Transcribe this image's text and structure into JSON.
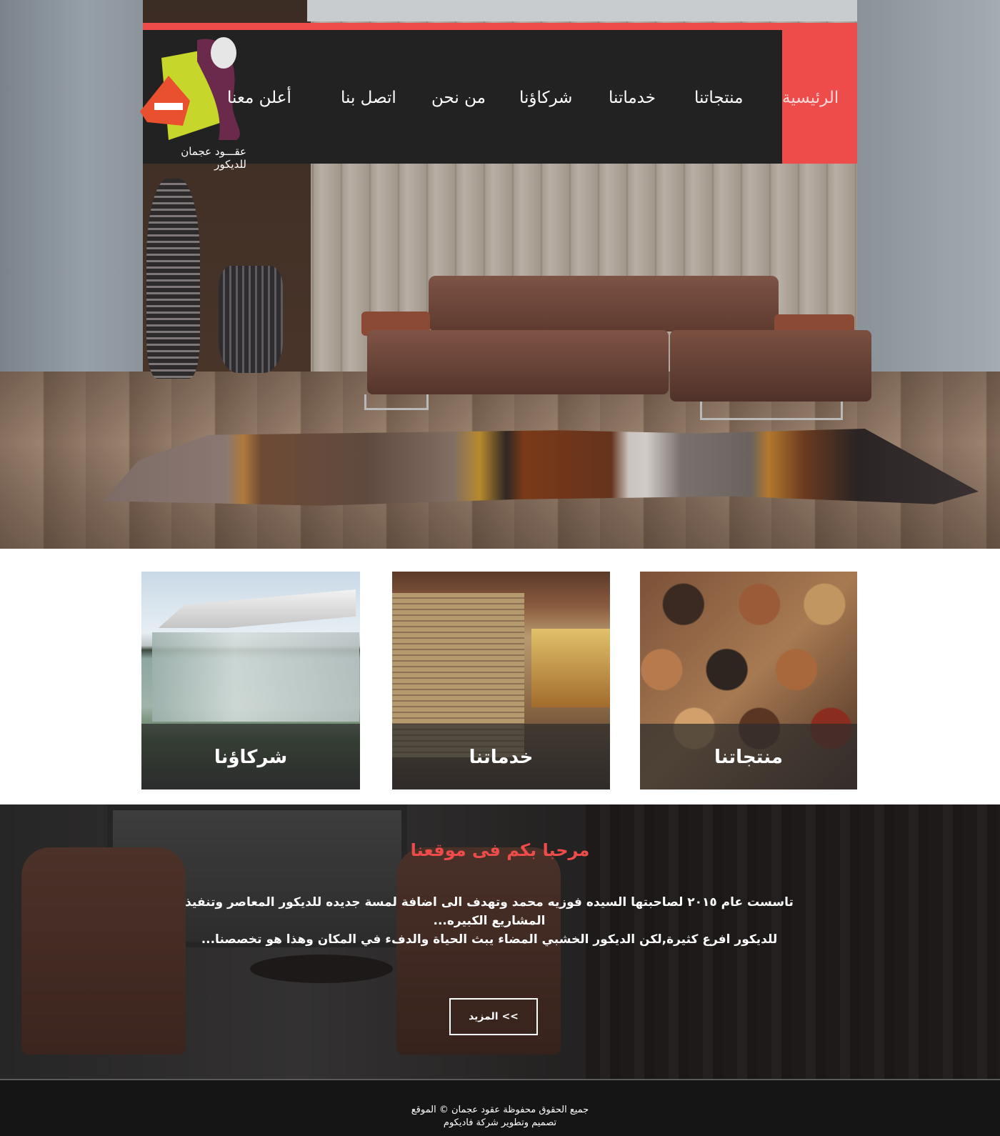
{
  "brand": {
    "logo_text": "عقـــود عجمان للديكور",
    "accent_color": "#ee4b4b",
    "nav_bg_color": "#222222"
  },
  "nav": {
    "items": [
      {
        "label": "الرئيسية",
        "active": true
      },
      {
        "label": "منتجاتنا"
      },
      {
        "label": "خدماتنا"
      },
      {
        "label": "شركاؤنا"
      },
      {
        "label": "من نحن"
      },
      {
        "label": "اتصل بنا"
      },
      {
        "label": "أعلن معنا"
      }
    ]
  },
  "cards": [
    {
      "title": "شركاؤنا"
    },
    {
      "title": "خدماتنا"
    },
    {
      "title": "منتجاتنا"
    }
  ],
  "welcome": {
    "title": "مرحبا بكم فى موقعنا",
    "paragraph_1": "تاسست عام ٢٠١٥ لصاحبتها السيده فوزيه محمد وتهدف الى اضافة لمسة جديده للديكور المعاصر وتنفيذ المشاريع الكبيره...",
    "paragraph_2": "للديكور افرع كثيرة,لكن الديكور الخشبي المضاء يبث الحياة والدفء في المكان وهذا هو تخصصنا...",
    "more_button": "المزيد <<"
  },
  "footer": {
    "copyright": "جميع الحقوق محفوظة عقود عجمان © الموقع",
    "credit": "تصميم وتطوير شركة فاديكوم"
  }
}
